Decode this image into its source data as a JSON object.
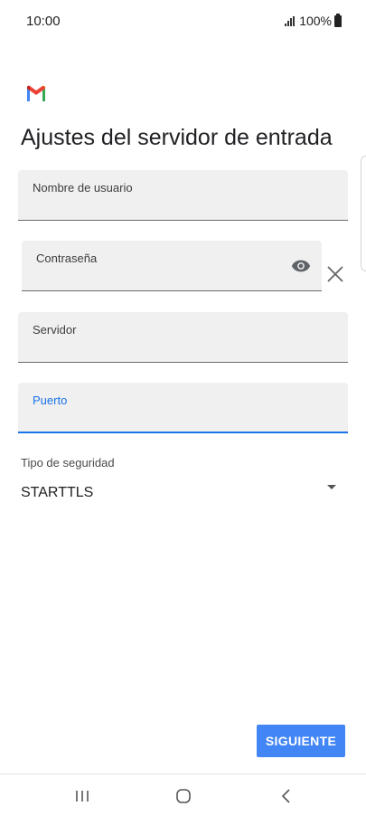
{
  "status_bar": {
    "time": "10:00",
    "battery_text": "100%"
  },
  "app": {
    "logo_icon": "gmail-logo-icon",
    "title": "Ajustes del servidor de entrada"
  },
  "form": {
    "username": {
      "label": "Nombre de usuario",
      "value": ""
    },
    "password": {
      "label": "Contraseña",
      "value": ""
    },
    "server": {
      "label": "Servidor",
      "value": ""
    },
    "port": {
      "label": "Puerto",
      "value": ""
    }
  },
  "security": {
    "label": "Tipo de seguridad",
    "selected": "STARTTLS"
  },
  "actions": {
    "next_label": "SIGUIENTE"
  },
  "colors": {
    "accent": "#1a73e8",
    "button": "#4285f4",
    "field_bg": "#f0f0f0"
  },
  "nav": {
    "recents_icon": "recents-icon",
    "home_icon": "home-icon",
    "back_icon": "back-icon"
  }
}
